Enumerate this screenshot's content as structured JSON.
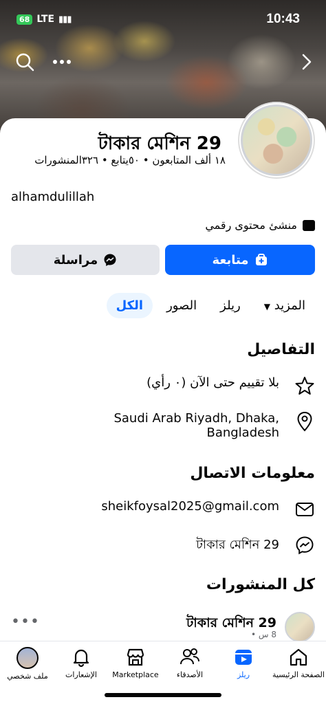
{
  "status_bar": {
    "battery": "68",
    "network": "LTE",
    "time": "10:43"
  },
  "profile": {
    "name": "টাকার মেশিন 29",
    "stats": "١٨ ألف المتابعون • ٥٠يتابع • ٣٢٦المنشورات",
    "bio": "alhamdulillah",
    "category": "منشئ محتوى رقمي"
  },
  "actions": {
    "follow": "متابعة",
    "message": "مراسلة"
  },
  "tabs": {
    "all": "الكل",
    "photos": "الصور",
    "reels": "ريلز",
    "more": "المزيد"
  },
  "details": {
    "title": "التفاصيل",
    "rating": "بلا تقييم حتى الآن (٠ رأي)",
    "location_line1": "Saudi Arab Riyadh, Dhaka,",
    "location_line2": "Bangladesh"
  },
  "contact": {
    "title": "معلومات الاتصال",
    "email": "sheikfoysal2025@gmail.com",
    "messenger": "টাকার মেশিন 29"
  },
  "posts": {
    "title": "كل المنشورات",
    "author": "টাকার মেশিন 29",
    "meta": "8 س •"
  },
  "nav": {
    "home": "الصفحة الرئيسية",
    "reels": "ريلز",
    "friends": "الأصدقاء",
    "marketplace": "Marketplace",
    "notifications": "الإشعارات",
    "profile": "ملف شخصي"
  },
  "colors": {
    "accent": "#0866ff",
    "secondary_button": "#e4e6eb",
    "battery": "#34c759"
  }
}
